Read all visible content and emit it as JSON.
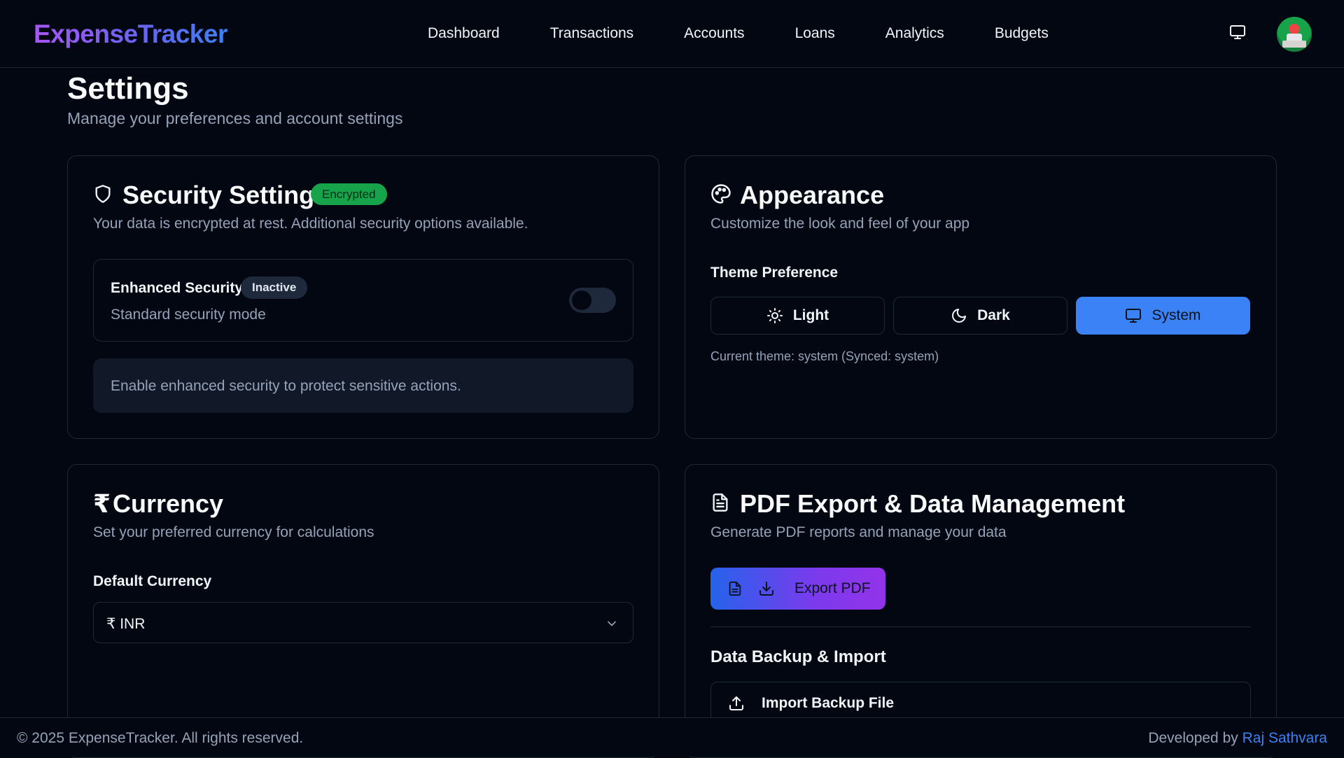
{
  "app": {
    "name": "ExpenseTracker",
    "brand_gradient": [
      "#a855f7",
      "#6366f1",
      "#3b82f6"
    ]
  },
  "nav": {
    "items": [
      {
        "label": "Dashboard"
      },
      {
        "label": "Transactions"
      },
      {
        "label": "Accounts"
      },
      {
        "label": "Loans"
      },
      {
        "label": "Analytics"
      },
      {
        "label": "Budgets"
      }
    ],
    "theme_icon": "monitor-icon",
    "avatar_icon": "user-avatar"
  },
  "page": {
    "title": "Settings",
    "subtitle": "Manage your preferences and account settings"
  },
  "security": {
    "icon": "shield-icon",
    "title": "Security Settings",
    "badge": "Encrypted",
    "badge_color": "#16a34a",
    "description": "Your data is encrypted at rest. Additional security options available.",
    "enhanced": {
      "label": "Enhanced Security",
      "status": "Inactive",
      "subtitle": "Standard security mode",
      "enabled": false
    },
    "note": "Enable enhanced security to protect sensitive actions."
  },
  "appearance": {
    "icon": "palette-icon",
    "title": "Appearance",
    "description": "Customize the look and feel of your app",
    "theme_label": "Theme Preference",
    "options": [
      {
        "label": "Light",
        "icon": "sun-icon"
      },
      {
        "label": "Dark",
        "icon": "moon-icon"
      },
      {
        "label": "System",
        "icon": "monitor-icon"
      }
    ],
    "selected": "System",
    "accent_color": "#3b82f6",
    "current": "Current theme: system (Synced: system)"
  },
  "currency": {
    "symbol": "₹",
    "title": "Currency",
    "description": "Set your preferred currency for calculations",
    "field_label": "Default Currency",
    "selected": "₹ INR"
  },
  "pdf": {
    "icon": "file-text-icon",
    "title": "PDF Export & Data Management",
    "description": "Generate PDF reports and manage your data",
    "export_label": "Export PDF",
    "backup_label": "Data Backup & Import",
    "import_label": "Import Backup File"
  },
  "footer": {
    "copyright": "© 2025 ExpenseTracker. All rights reserved.",
    "developed_by": "Developed by",
    "developer": "Raj Sathvara",
    "link_color": "#3b82f6"
  }
}
